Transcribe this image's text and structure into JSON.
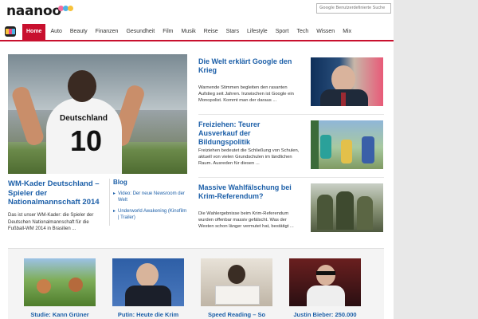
{
  "header": {
    "logo_text": "naanoo",
    "logo_dot_colors": [
      "#f26c9e",
      "#4db4e6",
      "#f7c23b"
    ],
    "search_brand": "Google",
    "search_placeholder": "Benutzerdefinierte Suche"
  },
  "nav": {
    "items": [
      "Home",
      "Auto",
      "Beauty",
      "Finanzen",
      "Gesundheit",
      "Film",
      "Musik",
      "Reise",
      "Stars",
      "Lifestyle",
      "Sport",
      "Tech",
      "Wissen",
      "Mix"
    ],
    "active_index": 0,
    "accent_color": "#c8102e"
  },
  "hero": {
    "jersey_name": "Deutschland",
    "jersey_number": "10",
    "title": "WM-Kader Deutschland – Spieler der Nationalmannschaft 2014",
    "description": "Das ist unser WM-Kader: die Spieler der Deutschen Nationalmannschaft für die Fußball-WM 2014 in Brasilien ..."
  },
  "blog": {
    "title": "Blog",
    "items": [
      "Video: Der neue Newsroom der Welt",
      "Underworld Awakening (Kinofilm | Trailer)"
    ]
  },
  "articles": [
    {
      "title": "Die Welt erklärt Google den Krieg",
      "description": "Warnende Stimmen begleiten den rasanten Aufstieg seit Jahren. Inzwischen ist Google ein Monopolist. Kommt man der daraus ..."
    },
    {
      "title": "Freiziehen: Teurer Ausverkauf der Bildungspolitik",
      "description": "Freiziehen bedeutet die Schließung von Schulen, aktuell von vielen Grundschulen im ländlichen Raum. Ausreden für diesen ..."
    },
    {
      "title": "Massive Wahlfälschung bei Krim-Referendum?",
      "description": "Die Wahlergebnisse beim Krim-Referendum wurden offenbar massiv gefälscht. Was der Westen schon länger vermutet hat, bestätigt ..."
    }
  ],
  "tiles": [
    {
      "title": "Studie: Kann Grüner"
    },
    {
      "title": "Putin: Heute die Krim"
    },
    {
      "title": "Speed Reading – So"
    },
    {
      "title": "Justin Bieber: 250.000"
    }
  ]
}
